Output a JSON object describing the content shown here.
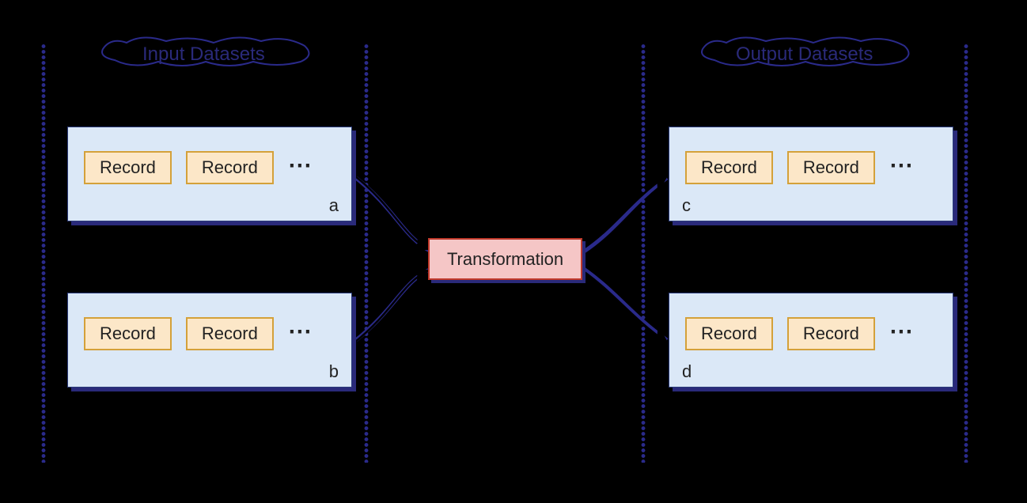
{
  "groups": {
    "input_title": "Input Datasets",
    "output_title": "Output Datasets"
  },
  "transform_label": "Transformation",
  "record_label": "Record",
  "ellipsis": "⋯",
  "datasets": {
    "a": {
      "label": "a"
    },
    "b": {
      "label": "b"
    },
    "c": {
      "label": "c"
    },
    "d": {
      "label": "d"
    }
  }
}
